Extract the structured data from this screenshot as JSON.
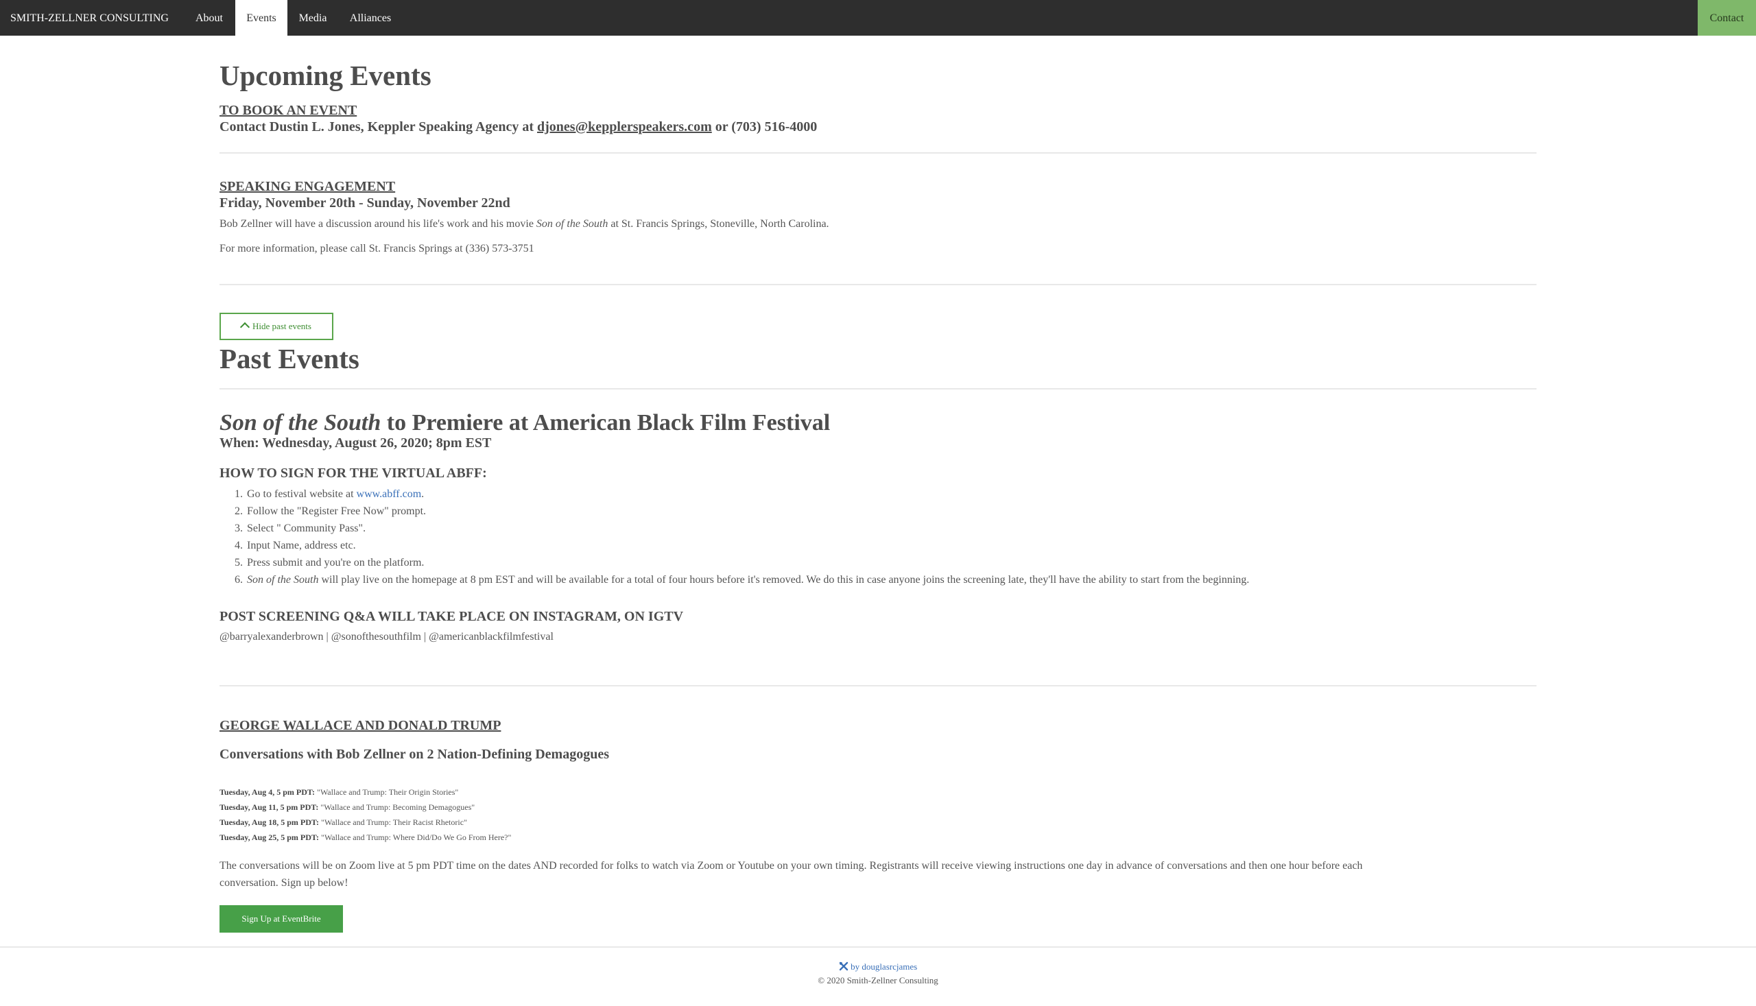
{
  "nav": {
    "brand": "SMITH-ZELLNER CONSULTING",
    "items": [
      "About",
      "Events",
      "Media",
      "Alliances"
    ],
    "active": "Events",
    "contact": "Contact"
  },
  "upcoming": {
    "title": "Upcoming Events",
    "book_label": "TO BOOK AN EVENT",
    "book_text_pre": "Contact Dustin L. Jones, Keppler Speaking Agency at ",
    "book_email": "djones@kepplerspeakers.com",
    "book_text_post": " or (703) 516-4000",
    "engagement_label": "SPEAKING ENGAGEMENT",
    "engagement_date": "Friday, November 20th - Sunday, November 22nd",
    "engagement_desc_pre": "Bob Zellner will have a discussion around his life's work and his movie ",
    "engagement_desc_movie": "Son of the South",
    "engagement_desc_post": " at St. Francis Springs, Stoneville, North Carolina.",
    "engagement_info": "For more information, please call St. Francis Springs at (336) 573-3751"
  },
  "toggle": {
    "label": "Hide past events"
  },
  "past": {
    "title": "Past Events",
    "event1": {
      "title_italic": "Son of the South",
      "title_rest": " to Premiere at American Black Film Festival",
      "when": "When: Wednesday, August 26, 2020; 8pm EST",
      "howto_heading": "HOW TO SIGN FOR THE VIRTUAL ABFF:",
      "steps": [
        {
          "num": "1.",
          "pre": "Go to festival website at ",
          "link": "www.abff.com",
          "post": "."
        },
        {
          "num": "2.",
          "pre": "Follow the \"Register Free Now\" prompt.",
          "link": "",
          "post": ""
        },
        {
          "num": "3.",
          "pre": "Select \" Community Pass\".",
          "link": "",
          "post": ""
        },
        {
          "num": "4.",
          "pre": "Input Name, address etc.",
          "link": "",
          "post": ""
        },
        {
          "num": "5.",
          "pre": "Press submit and you're on the platform.",
          "link": "",
          "post": ""
        }
      ],
      "step6_num": "6.",
      "step6_italic": "Son of the South",
      "step6_rest": " will play live on the homepage at 8 pm EST and will be available for a total of four hours before it's removed. We do this in case anyone joins the screening late, they'll have the ability to start from the beginning.",
      "qa_heading": "POST SCREENING Q&A WILL TAKE PLACE ON INSTAGRAM, ON IGTV",
      "handles": "@barryalexanderbrown | @sonofthesouthfilm | @americanblackfilmfestival"
    },
    "event2": {
      "label": "GEORGE WALLACE AND DONALD TRUMP",
      "subtitle": "Conversations with Bob Zellner on 2 Nation-Defining Demagogues",
      "schedule": [
        {
          "when": "Tuesday, Aug 4, 5 pm PDT:",
          "title": " \"Wallace and Trump: Their Origin Stories\""
        },
        {
          "when": "Tuesday, Aug 11, 5 pm PDT:",
          "title": " \"Wallace and Trump: Becoming Demagogues\""
        },
        {
          "when": "Tuesday, Aug 18, 5 pm PDT:",
          "title": " \"Wallace and Trump: Their Racist Rhetoric\""
        },
        {
          "when": "Tuesday, Aug 25, 5 pm PDT:",
          "title": " \"Wallace and Trump: Where Did/Do We Go From Here?\""
        }
      ],
      "desc_line1": "The conversations will be on Zoom live at 5 pm PDT time on the dates AND recorded for folks to watch via Zoom or Youtube on your own timing. Registrants will receive viewing instructions one day in advance of conversations and then one hour before each",
      "desc_line2": "conversation. Sign up below!",
      "button": "Sign Up at EventBrite"
    }
  },
  "footer": {
    "credit_icon": "tools-icon",
    "credit": " by douglasrcjames",
    "copyright": "© 2020 Smith-Zellner Consulting"
  },
  "colors": {
    "navbar": "#2e2e2e",
    "contact_bg": "#7fb86a",
    "button_green": "#47a048",
    "link_blue": "#3a70b8"
  }
}
